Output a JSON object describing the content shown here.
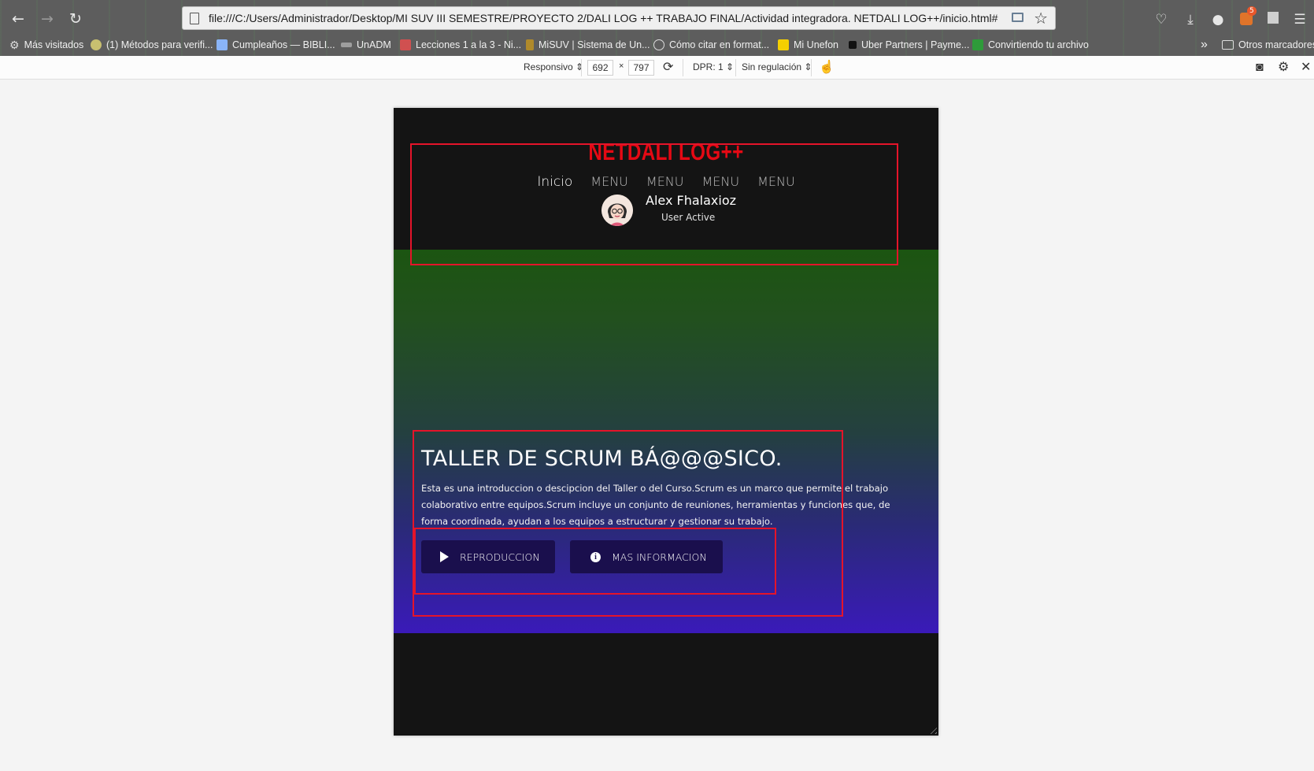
{
  "browser": {
    "url": "file:///C:/Users/Administrador/Desktop/MI SUV III SEMESTRE/PROYECTO 2/DALI LOG ++ TRABAJO FINAL/Actividad integradora. NETDALI LOG++/inicio.html#",
    "bookmarks": [
      {
        "label": "Más visitados",
        "icon": "gear-icon",
        "color": "#dddddd"
      },
      {
        "label": "(1) Métodos para verifi...",
        "icon": "bookmark-favicon",
        "color": "#c8c070"
      },
      {
        "label": "Cumpleaños — BIBLI...",
        "icon": "bookmark-favicon",
        "color": "#8ab4f8"
      },
      {
        "label": "UnADM",
        "icon": "bookmark-favicon",
        "color": "#9e9e9e"
      },
      {
        "label": "Lecciones 1 a la 3 - Ni...",
        "icon": "bookmark-favicon",
        "color": "#d05050"
      },
      {
        "label": "MiSUV | Sistema de Un...",
        "icon": "bookmark-favicon",
        "color": "#b08a2a"
      },
      {
        "label": "Cómo citar en format...",
        "icon": "globe-icon",
        "color": "#dddddd"
      },
      {
        "label": "Mi Unefon",
        "icon": "bookmark-favicon",
        "color": "#f5d000"
      },
      {
        "label": "Uber Partners | Payme...",
        "icon": "bookmark-favicon",
        "color": "#111111"
      },
      {
        "label": "Convirtiendo tu archivo",
        "icon": "bookmark-favicon",
        "color": "#2e9b3a"
      }
    ],
    "overflow": "»",
    "other_bookmarks": "Otros marcadores",
    "badge_count": "5"
  },
  "responsive_bar": {
    "mode": "Responsivo",
    "width": "692",
    "times": "×",
    "height": "797",
    "dpr": "DPR: 1",
    "throttling": "Sin regulación"
  },
  "site": {
    "logo": "NETDALI LOG++",
    "nav": [
      "Inicio",
      "MENU",
      "MENU",
      "MENU",
      "MENU"
    ],
    "user": {
      "name": "Alex Fhalaxioz",
      "status": "User Active"
    },
    "hero": {
      "title": "TALLER DE SCRUM BÁ@@@SICO.",
      "description": "Esta es una introduccion o descipcion del Taller o del Curso.Scrum es un marco que permite el trabajo colaborativo entre equipos.Scrum incluye un conjunto de reuniones, herramientas y funciones que, de forma coordinada, ayudan a los equipos a estructurar y gestionar su trabajo.",
      "buttons": {
        "play": "REPRODUCCION",
        "info": "MAS INFORMACION",
        "info_glyph": "i"
      }
    },
    "colors": {
      "brand": "#e50914",
      "button_bg": "#1a0f4d",
      "annotation": "#e5142a"
    }
  }
}
